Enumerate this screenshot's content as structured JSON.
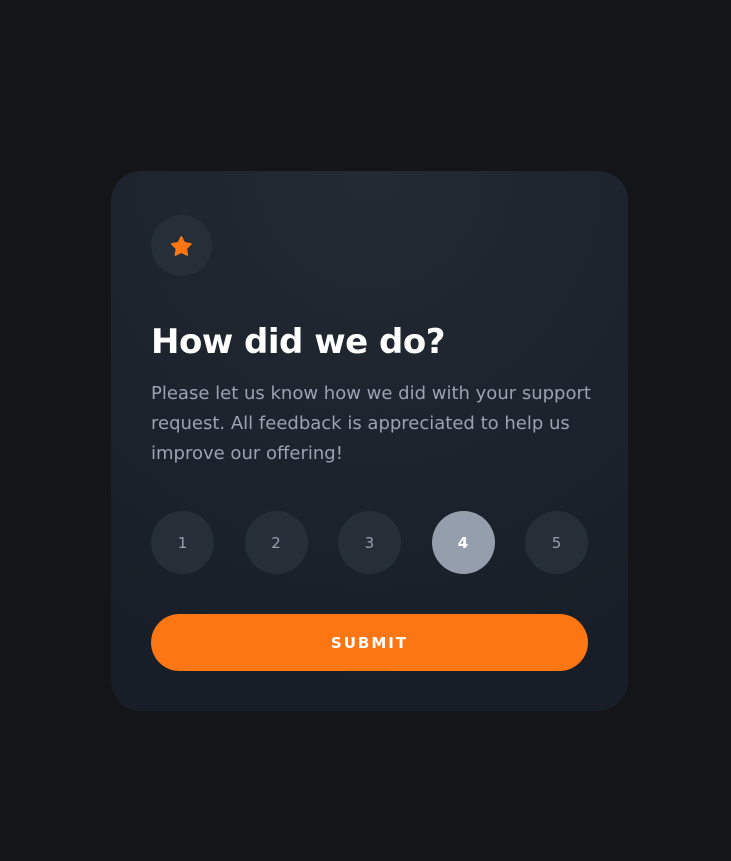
{
  "card": {
    "icon": "star-icon",
    "title": "How did we do?",
    "description": "Please let us know how we did with your support request. All feedback is appreciated to help us improve our offering!",
    "ratings": [
      "1",
      "2",
      "3",
      "4",
      "5"
    ],
    "selected_rating": "4",
    "submit_label": "SUBMIT"
  },
  "colors": {
    "page_background": "#131518",
    "card_background": "#1F2630",
    "accent_orange": "#FC7614",
    "rating_background": "#262E38",
    "rating_selected": "#959EAC",
    "text_white": "#FFFFFF",
    "text_muted": "#9AA3B2"
  }
}
